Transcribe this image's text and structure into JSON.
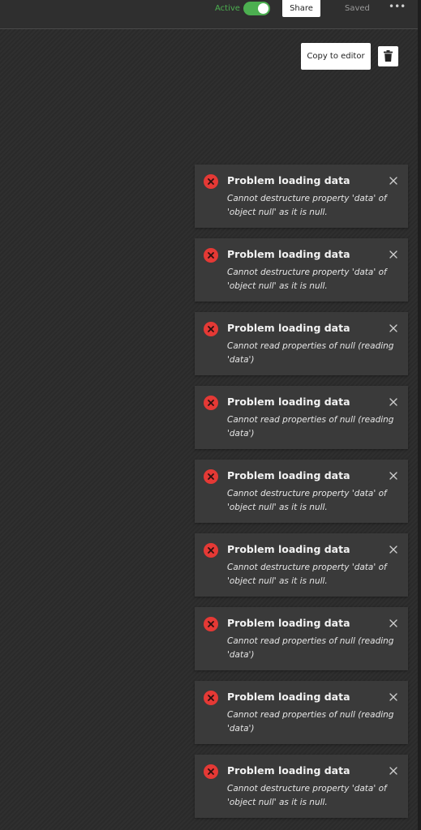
{
  "header": {
    "active_label": "Active",
    "active_toggle_on": true,
    "share_label": "Share",
    "status_label": "Saved",
    "more_label": "•••"
  },
  "toolbar": {
    "copy_label": "Copy to editor",
    "delete_icon": "trash-icon"
  },
  "colors": {
    "accent_green": "#4caf50",
    "error_red": "#e53935",
    "toast_bg": "#3a3a3a",
    "page_bg": "#2b2b2b"
  },
  "toasts": [
    {
      "title": "Problem loading data",
      "message": "Cannot destructure property 'data' of 'object null' as it is null."
    },
    {
      "title": "Problem loading data",
      "message": "Cannot destructure property 'data' of 'object null' as it is null."
    },
    {
      "title": "Problem loading data",
      "message": "Cannot read properties of null (reading 'data')"
    },
    {
      "title": "Problem loading data",
      "message": "Cannot read properties of null (reading 'data')"
    },
    {
      "title": "Problem loading data",
      "message": "Cannot destructure property 'data' of 'object null' as it is null."
    },
    {
      "title": "Problem loading data",
      "message": "Cannot destructure property 'data' of 'object null' as it is null."
    },
    {
      "title": "Problem loading data",
      "message": "Cannot read properties of null (reading 'data')"
    },
    {
      "title": "Problem loading data",
      "message": "Cannot read properties of null (reading 'data')"
    },
    {
      "title": "Problem loading data",
      "message": "Cannot destructure property 'data' of 'object null' as it is null."
    }
  ]
}
